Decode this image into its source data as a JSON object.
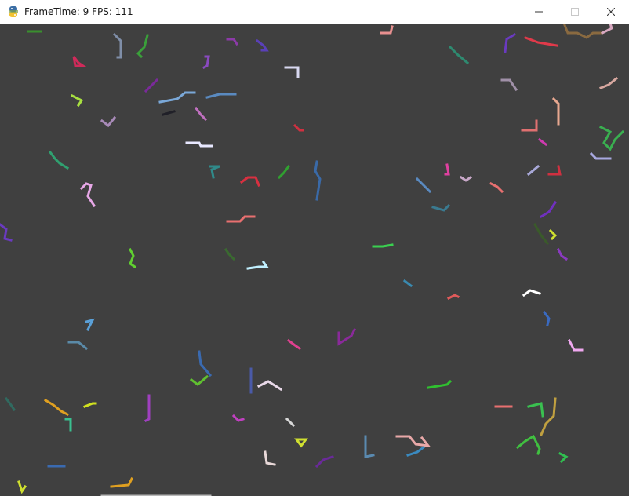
{
  "window": {
    "title": "FrameTime: 9 FPS: 111",
    "icons": {
      "app": "python-snake-icon",
      "minimize": "minimize-icon",
      "maximize": "maximize-icon",
      "close": "close-icon"
    }
  },
  "canvas": {
    "background": "#404040",
    "content": "random-walker-trails"
  }
}
